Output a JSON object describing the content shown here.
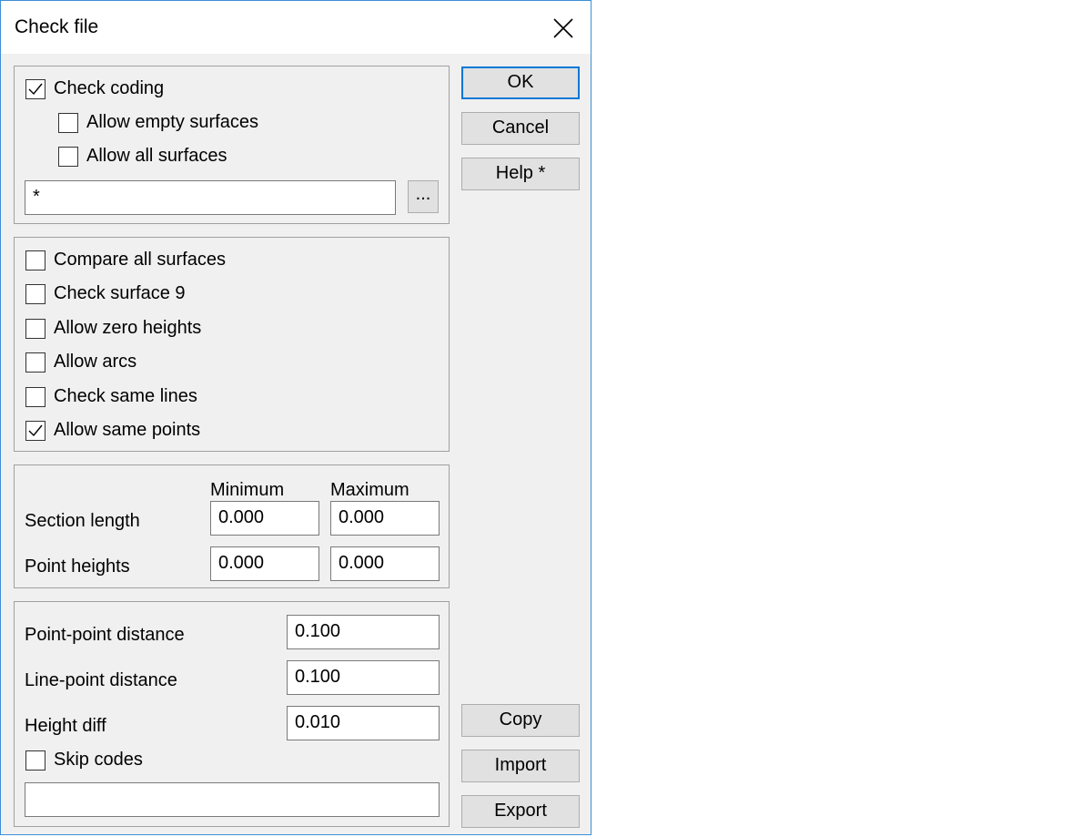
{
  "window": {
    "title": "Check file"
  },
  "coding": {
    "check_coding": {
      "label": "Check coding",
      "checked": true
    },
    "allow_empty": {
      "label": "Allow empty surfaces",
      "checked": false
    },
    "allow_all": {
      "label": "Allow all surfaces",
      "checked": false
    },
    "surface_filter": "*",
    "browse_label": "..."
  },
  "checks": [
    {
      "label": "Compare all surfaces",
      "checked": false
    },
    {
      "label": "Check surface 9",
      "checked": false
    },
    {
      "label": "Allow zero heights",
      "checked": false
    },
    {
      "label": "Allow arcs",
      "checked": false
    },
    {
      "label": "Check same lines",
      "checked": false
    },
    {
      "label": "Allow same points",
      "checked": true
    }
  ],
  "ranges": {
    "min_header": "Minimum",
    "max_header": "Maximum",
    "rows": [
      {
        "label": "Section length",
        "min": "0.000",
        "max": "0.000"
      },
      {
        "label": "Point heights",
        "min": "0.000",
        "max": "0.000"
      }
    ]
  },
  "tolerances": {
    "rows": [
      {
        "label": "Point-point distance",
        "value": "0.100"
      },
      {
        "label": "Line-point distance",
        "value": "0.100"
      },
      {
        "label": "Height diff",
        "value": "0.010"
      }
    ],
    "skip_codes": {
      "label": "Skip codes",
      "checked": false
    },
    "skip_codes_value": ""
  },
  "buttons": {
    "ok": "OK",
    "cancel": "Cancel",
    "help": "Help *",
    "copy": "Copy",
    "import": "Import",
    "export": "Export"
  }
}
